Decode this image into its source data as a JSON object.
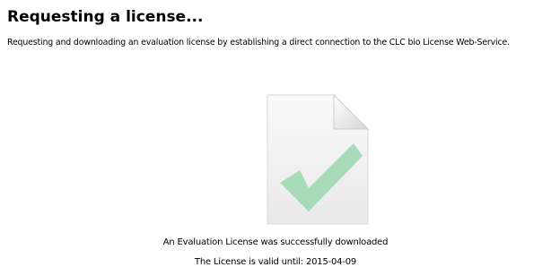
{
  "header": {
    "title": "Requesting a license...",
    "description": "Requesting and downloading an evaluation license by establishing a direct connection to the CLC bio License Web-Service."
  },
  "status": {
    "icon": "document-checkmark-icon",
    "check_color": "#9fd8b3",
    "message": "An Evaluation License was successfully downloaded",
    "validity": "The License is valid until: 2015-04-09"
  }
}
